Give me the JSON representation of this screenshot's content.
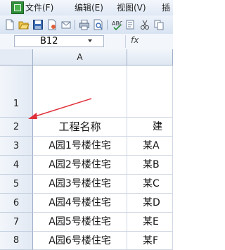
{
  "menubar": {
    "items": [
      "文件(F)",
      "编辑(E)",
      "视图(V)",
      "插"
    ]
  },
  "toolbar": {
    "icons": [
      "new-icon",
      "open-icon",
      "save-icon",
      "permission-icon",
      "print-icon",
      "print-preview-icon",
      "spellcheck-icon"
    ]
  },
  "formula_bar": {
    "name_box": "B12",
    "fx_label": "fx",
    "content": ""
  },
  "sheet": {
    "columns": [
      "A",
      ""
    ],
    "rows": [
      {
        "num": "1",
        "a": "",
        "b": ""
      },
      {
        "num": "2",
        "a": "工程名称",
        "b": "建"
      },
      {
        "num": "3",
        "a": "A园1号楼住宅",
        "b": "某A"
      },
      {
        "num": "4",
        "a": "A园2号楼住宅",
        "b": "某B"
      },
      {
        "num": "5",
        "a": "A园3号楼住宅",
        "b": "某C"
      },
      {
        "num": "6",
        "a": "A园4号楼住宅",
        "b": "某D"
      },
      {
        "num": "7",
        "a": "A园5号楼住宅",
        "b": "某E"
      },
      {
        "num": "8",
        "a": "A园6号楼住宅",
        "b": "某F"
      }
    ]
  },
  "annotation": {
    "arrow_color": "#e0303a"
  }
}
